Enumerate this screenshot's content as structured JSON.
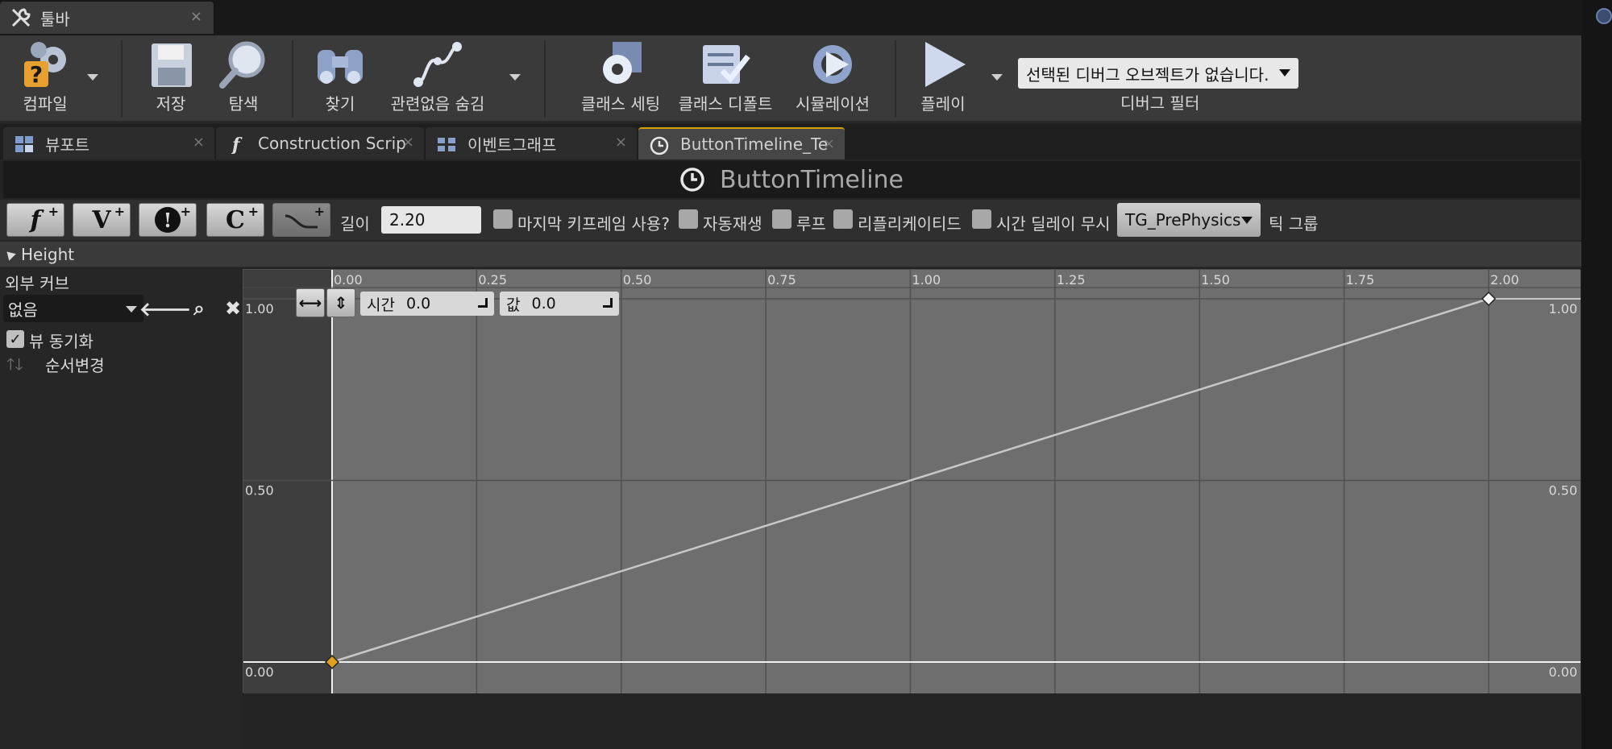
{
  "window": {
    "tab_label": "툴바",
    "tab_close": "×"
  },
  "toolbar": {
    "compile": "컴파일",
    "save": "저장",
    "browse": "탐색",
    "find": "찾기",
    "hide_unrelated": "관련없음 숨김",
    "class_settings": "클래스 세팅",
    "class_defaults": "클래스 디폴트",
    "simulation": "시뮬레이션",
    "play": "플레이",
    "debug_select_value": "선택된 디버그 오브젝트가 없습니다.",
    "debug_filter_label": "디버그 필터"
  },
  "doc_tabs": [
    {
      "label": "뷰포트",
      "close": "×"
    },
    {
      "label": "Construction Scrip",
      "close": "×"
    },
    {
      "label": "이벤트그래프",
      "close": "×"
    },
    {
      "label": "ButtonTimeline_Te",
      "close": "×"
    }
  ],
  "timeline": {
    "title": "ButtonTimeline",
    "add_buttons": [
      "f",
      "V",
      "!",
      "C"
    ],
    "length_label": "길이",
    "length_value": "2.20",
    "use_last_keyframe": "마지막 키프레임 사용?",
    "autoplay": "자동재생",
    "loop": "루프",
    "replicated": "리플리케이티드",
    "ignore_time_dilation": "시간 딜레이 무시",
    "tick_group_value": "TG_PrePhysics",
    "tick_group_label": "틱 그룹"
  },
  "track": {
    "name": "Height",
    "external_curve_label": "외부 커브",
    "external_curve_value": "없음",
    "sync_view_label": "뷰 동기화",
    "reorder_label": "순서변경",
    "time_label": "시간",
    "time_value": "0.0",
    "value_label": "값",
    "value_value": "0.0"
  },
  "chart_data": {
    "type": "line",
    "x_ticks": [
      "0.00",
      "0.25",
      "0.50",
      "0.75",
      "1.00",
      "1.25",
      "1.50",
      "1.75",
      "2.00"
    ],
    "y_ticks": [
      "0.00",
      "0.50",
      "1.00"
    ],
    "xlim": [
      -0.15,
      2.15
    ],
    "ylim": [
      0,
      1
    ],
    "series": [
      {
        "values": [
          {
            "x": 0.0,
            "y": 0.0
          },
          {
            "x": 2.0,
            "y": 1.0
          }
        ]
      }
    ],
    "keys": [
      {
        "x": 0.0,
        "y": 0.0,
        "color": "#e0a020"
      },
      {
        "x": 2.0,
        "y": 1.0,
        "color": "#ffffff"
      }
    ],
    "grid": true
  }
}
